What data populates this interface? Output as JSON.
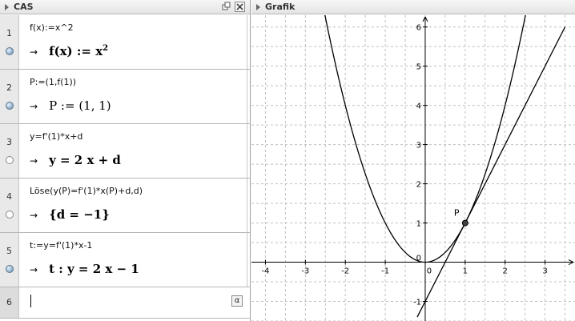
{
  "cas": {
    "title": "CAS",
    "restore_icon": "restore-icon",
    "close_icon": "close-icon",
    "rows": [
      {
        "num": "1",
        "input": "f(x):=x^2",
        "arrow": "→",
        "output_pre": "f(x) := x",
        "output_sup": "2",
        "marble": "filled"
      },
      {
        "num": "2",
        "input": "P:=(1,f(1))",
        "arrow": "→",
        "output_pre": "P := (1, 1)",
        "output_sup": "",
        "marble": "filled"
      },
      {
        "num": "3",
        "input": "y=f'(1)*x+d",
        "arrow": "→",
        "output_pre": "y = 2 x + d",
        "output_sup": "",
        "marble": "empty"
      },
      {
        "num": "4",
        "input": "Löse(y(P)=f'(1)*x(P)+d,d)",
        "arrow": "→",
        "output_pre": "{d = −1}",
        "output_sup": "",
        "marble": "empty"
      },
      {
        "num": "5",
        "input": "t:=y=f'(1)*x-1",
        "arrow": "→",
        "output_pre": "t : y = 2 x − 1",
        "output_sup": "",
        "marble": "filled"
      }
    ],
    "input_row": {
      "num": "6",
      "value": "",
      "alpha_label": "α"
    }
  },
  "graphics": {
    "title": "Grafik",
    "point_label": "P",
    "x_ticks": [
      "-4",
      "-3",
      "-2",
      "-1",
      "0",
      "1",
      "2",
      "3"
    ],
    "y_ticks": [
      "6",
      "5",
      "4",
      "3",
      "2",
      "1",
      "0",
      "-1"
    ],
    "curve_color": "#000000",
    "grid_color": "#c0c0c0"
  },
  "chart_data": {
    "type": "line",
    "series": [
      {
        "name": "f",
        "function": "x^2",
        "x_range": [
          -2.6,
          2.6
        ]
      },
      {
        "name": "t",
        "function": "2x-1",
        "x_range": [
          -0.2,
          3.5
        ]
      }
    ],
    "points": [
      {
        "label": "P",
        "x": 1,
        "y": 1
      }
    ],
    "xlim": [
      -4.35,
      3.75
    ],
    "ylim": [
      -1.5,
      6.3
    ],
    "grid": true
  }
}
